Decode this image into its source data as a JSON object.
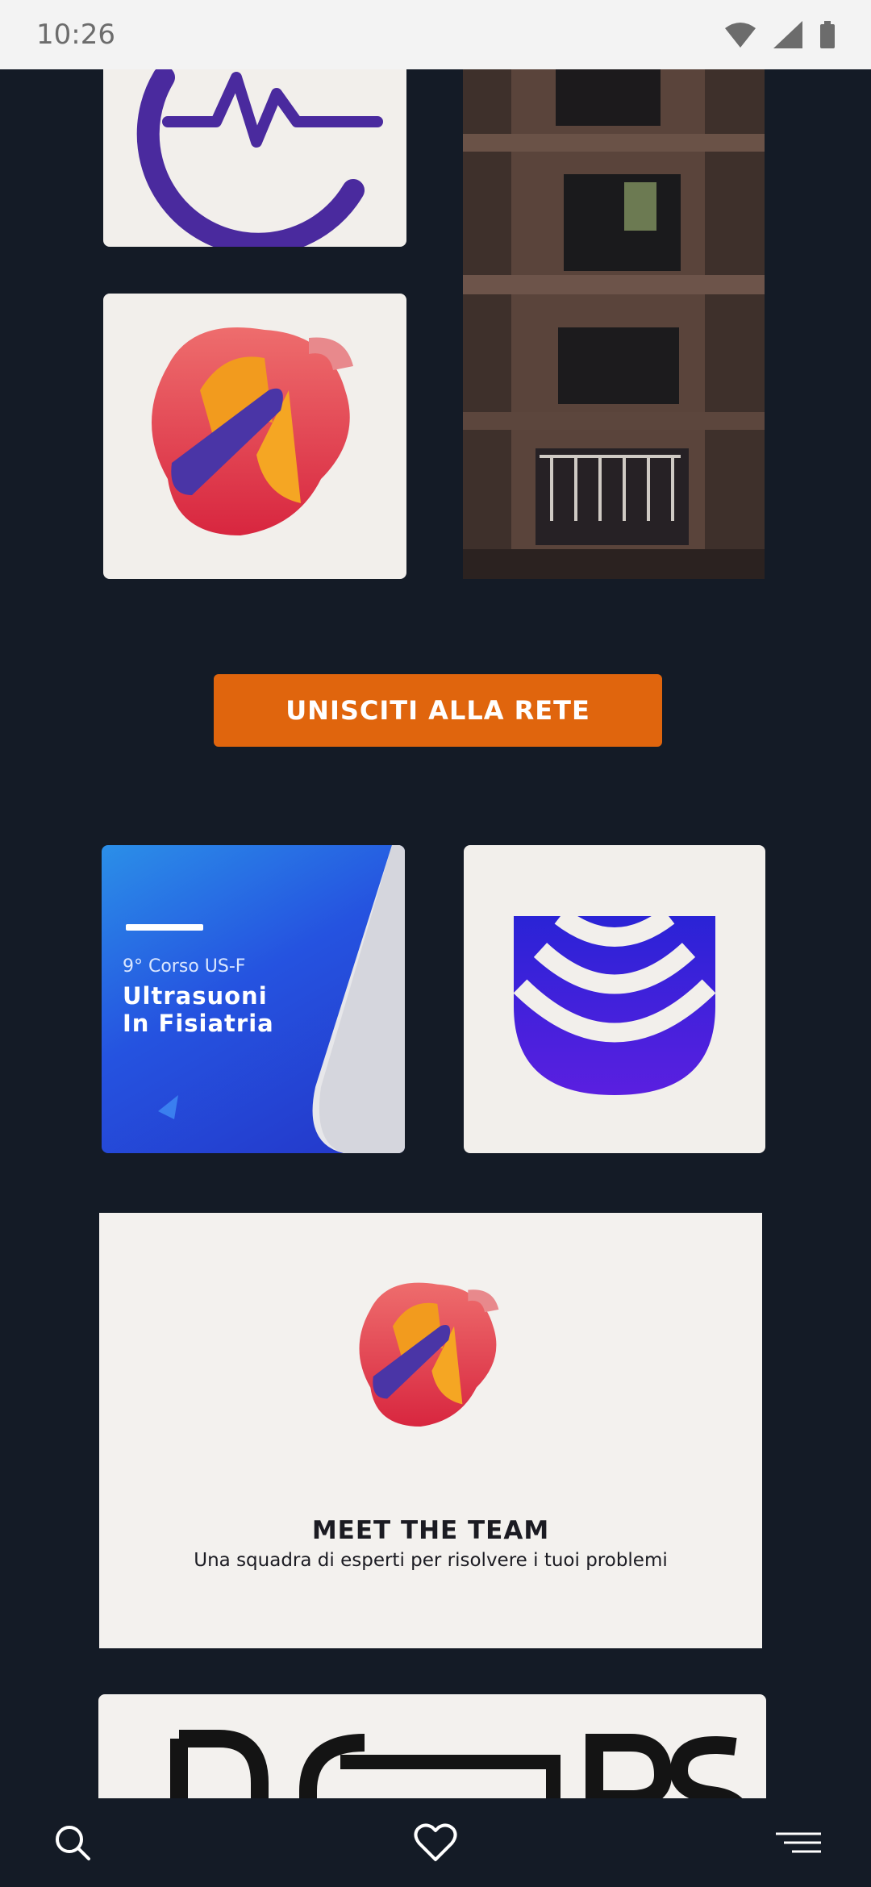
{
  "status_bar": {
    "time": "10:26"
  },
  "cta": {
    "label": "UNISCITI ALLA RETE"
  },
  "course_card": {
    "subtitle": "9° Corso US-F",
    "title_line1": "Ultrasuoni",
    "title_line2": "In Fisiatria"
  },
  "team_card": {
    "title": "MEET THE TEAM",
    "subtitle": "Una squadra di esperti per risolvere i tuoi problemi"
  },
  "partial_card": {
    "logo_text": "DO  RS"
  },
  "bottom_nav": [
    "search-icon",
    "heart-icon",
    "menu-icon"
  ],
  "colors": {
    "background": "#141b26",
    "accent": "#e0650d",
    "brand_purple": "#4a2a9e",
    "brand_red": "#e44b5c",
    "brand_blue": "#3a1de0"
  }
}
